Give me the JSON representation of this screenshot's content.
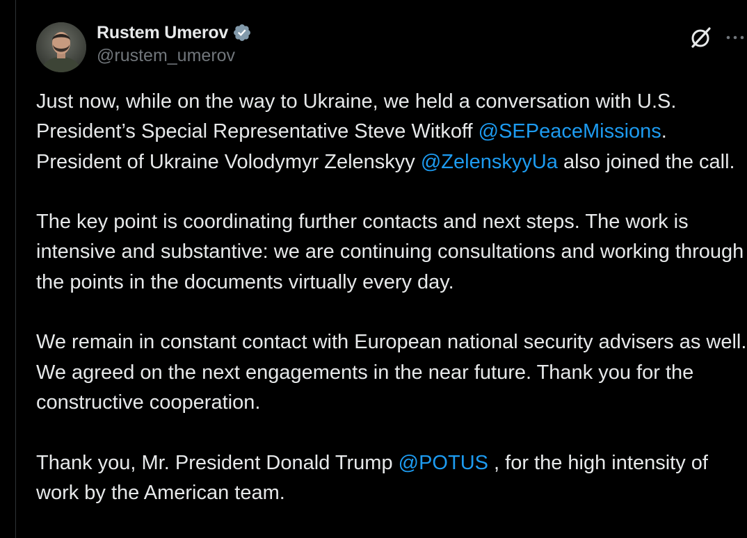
{
  "author": {
    "display_name": "Rustem Umerov",
    "handle": "@rustem_umerov",
    "verified_icon": "verified-badge-icon"
  },
  "actions": {
    "grok_icon": "grok-icon",
    "more_icon": "more-horizontal-icon"
  },
  "colors": {
    "background": "#000000",
    "text": "#e7e9ea",
    "secondary_text": "#71767b",
    "link": "#1d9bf0",
    "verified_badge": "#829aab"
  },
  "tweet": {
    "p1": {
      "t1": "Just now, while on the way to Ukraine, we held a conversation with U.S. President’s Special Representative Steve Witkoff ",
      "m1": "@SEPeaceMissions",
      "t2": ". President of Ukraine Volodymyr Zelenskyy ",
      "m2": "@ZelenskyyUa",
      "t3": " also joined the call."
    },
    "p2": "The key point is coordinating further contacts and next steps. The work is intensive and substantive: we are continuing consultations and working through the points in the documents virtually every day.",
    "p3": "We remain in constant contact with European national security advisers as well. We agreed on the next engagements in the near future. Thank you for the constructive cooperation.",
    "p4": {
      "t1": "Thank you, Mr. President Donald Trump ",
      "m1": "@POTUS",
      "t2": " , for the high intensity of work by the American team."
    }
  }
}
